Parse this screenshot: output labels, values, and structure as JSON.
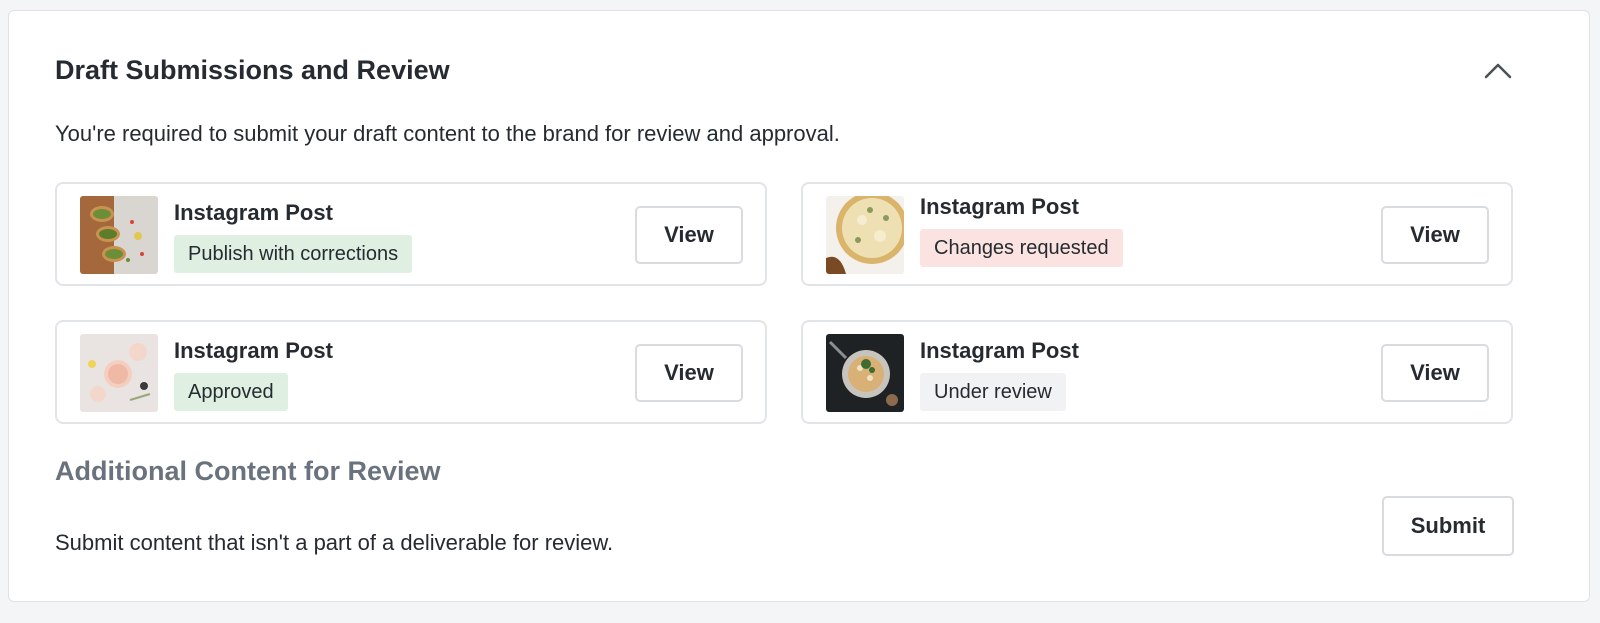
{
  "section": {
    "title": "Draft Submissions and Review",
    "description": "You're required to submit your draft content to the brand for review and approval.",
    "collapse_icon": "chevron-up-icon"
  },
  "submissions": [
    {
      "title": "Instagram Post",
      "status": "Publish with corrections",
      "status_bg": "#dff0e3",
      "view_label": "View",
      "thumbnail": "avocado-toast-photo"
    },
    {
      "title": "Instagram Post",
      "status": "Changes requested",
      "status_bg": "#fbe3e1",
      "view_label": "View",
      "thumbnail": "pizza-photo"
    },
    {
      "title": "Instagram Post",
      "status": "Approved",
      "status_bg": "#dff0e3",
      "view_label": "View",
      "thumbnail": "drinks-photo"
    },
    {
      "title": "Instagram Post",
      "status": "Under review",
      "status_bg": "#f1f2f4",
      "view_label": "View",
      "thumbnail": "food-bowl-photo"
    }
  ],
  "additional": {
    "title": "Additional Content for Review",
    "description": "Submit content that isn't a part of a deliverable for review.",
    "submit_label": "Submit"
  }
}
